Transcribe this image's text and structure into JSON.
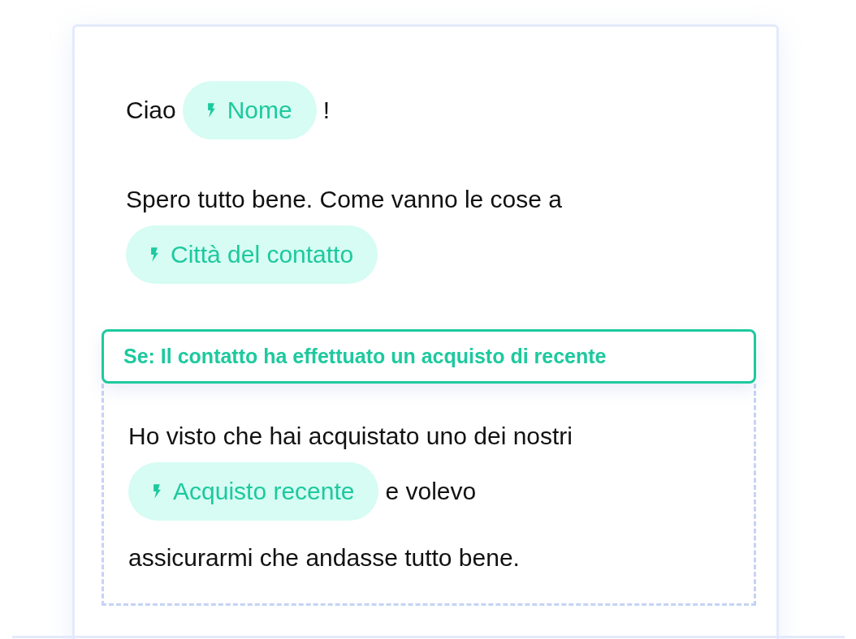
{
  "paragraphs": [
    {
      "rows": [
        [
          {
            "kind": "text",
            "text": "Ciao"
          },
          {
            "kind": "tag",
            "text": "Nome"
          },
          {
            "kind": "text",
            "text": "!"
          }
        ]
      ]
    },
    {
      "rows": [
        [
          {
            "kind": "text",
            "text": "Spero tutto bene. Come vanno le cose a"
          }
        ],
        [
          {
            "kind": "tag",
            "text": "Città del contatto"
          }
        ]
      ]
    }
  ],
  "condition": {
    "label": "Se: Il contatto ha effettuato un acquisto di recente",
    "rows": [
      [
        {
          "kind": "text",
          "text": "Ho visto che hai acquistato uno dei nostri"
        }
      ],
      [
        {
          "kind": "tag",
          "text": "Acquisto recente"
        },
        {
          "kind": "text",
          "text": "e volevo"
        }
      ],
      [
        {
          "kind": "text",
          "text": "assicurarmi che andasse tutto bene."
        }
      ]
    ]
  }
}
